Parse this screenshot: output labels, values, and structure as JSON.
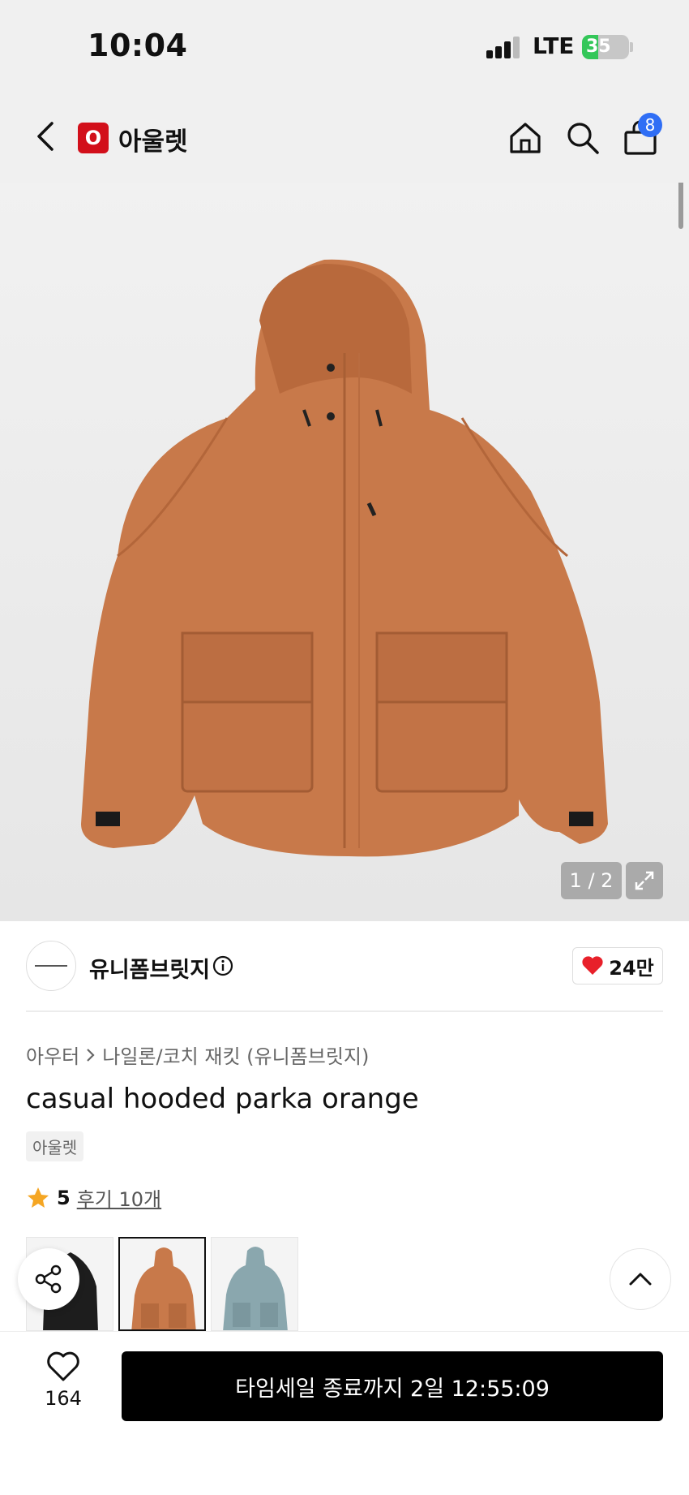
{
  "status_bar": {
    "time": "10:04",
    "network": "LTE",
    "battery": "35"
  },
  "header": {
    "brand_logo_letter": "O",
    "brand_name": "아울렛",
    "cart_count": "8"
  },
  "hero": {
    "image_counter": "1 / 2",
    "product_color": "#c8794a"
  },
  "seller": {
    "name": "유니폼브릿지",
    "likes": "24만"
  },
  "breadcrumb": {
    "category": "아우터",
    "subcategory": "나일론/코치 재킷 (유니폼브릿지)"
  },
  "product": {
    "title": "casual hooded parka orange",
    "tag": "아울렛",
    "rating_score": "5",
    "reviews_label": "후기 10개"
  },
  "variants": [
    {
      "color_name": "black",
      "hex": "#1d1d1d"
    },
    {
      "color_name": "orange",
      "hex": "#c8794a"
    },
    {
      "color_name": "sky",
      "hex": "#8aa7ae"
    }
  ],
  "bottom_bar": {
    "wishlist_count": "164",
    "cta_label": "타임세일 종료까지 2일 12:55:09"
  },
  "colors": {
    "accent_blue": "#2f6ef5",
    "brand_red": "#d20f1a",
    "heart_red": "#e8202a",
    "star": "#f5a623"
  },
  "icons": [
    "back-icon",
    "home-icon",
    "search-icon",
    "bag-icon",
    "info-icon",
    "heart-icon",
    "star-icon",
    "expand-icon",
    "share-icon",
    "chevron-up-icon"
  ]
}
